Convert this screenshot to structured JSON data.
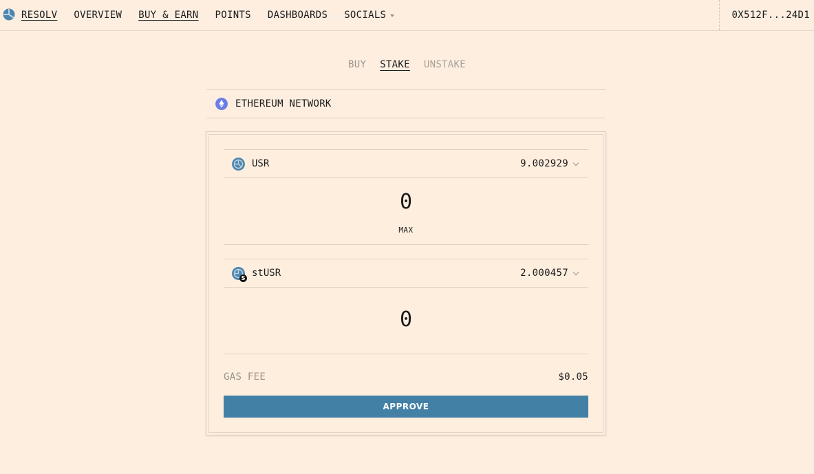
{
  "nav": {
    "brand": "RESOLV",
    "items": [
      {
        "label": "OVERVIEW"
      },
      {
        "label": "BUY & EARN"
      },
      {
        "label": "POINTS"
      },
      {
        "label": "DASHBOARDS"
      },
      {
        "label": "SOCIALS"
      }
    ],
    "wallet": "0X512F...24D1"
  },
  "tabs": [
    {
      "label": "BUY",
      "active": false
    },
    {
      "label": "STAKE",
      "active": true
    },
    {
      "label": "UNSTAKE",
      "active": false
    }
  ],
  "network": {
    "label": "ETHEREUM NETWORK",
    "icon": "ethereum-icon"
  },
  "from_token": {
    "symbol": "USR",
    "balance": "9.002929",
    "amount": "0",
    "max_label": "MAX",
    "icon": "usr-token-icon"
  },
  "to_token": {
    "symbol": "stUSR",
    "balance": "2.000457",
    "amount": "0",
    "badge": "S",
    "icon": "stusr-token-icon"
  },
  "gas": {
    "label": "GAS FEE",
    "value": "$0.05"
  },
  "action": {
    "label": "APPROVE"
  },
  "colors": {
    "background": "#fdeee0",
    "accent": "#4380a6",
    "ethereum": "#6b7de6",
    "muted_text": "#9b938a"
  }
}
